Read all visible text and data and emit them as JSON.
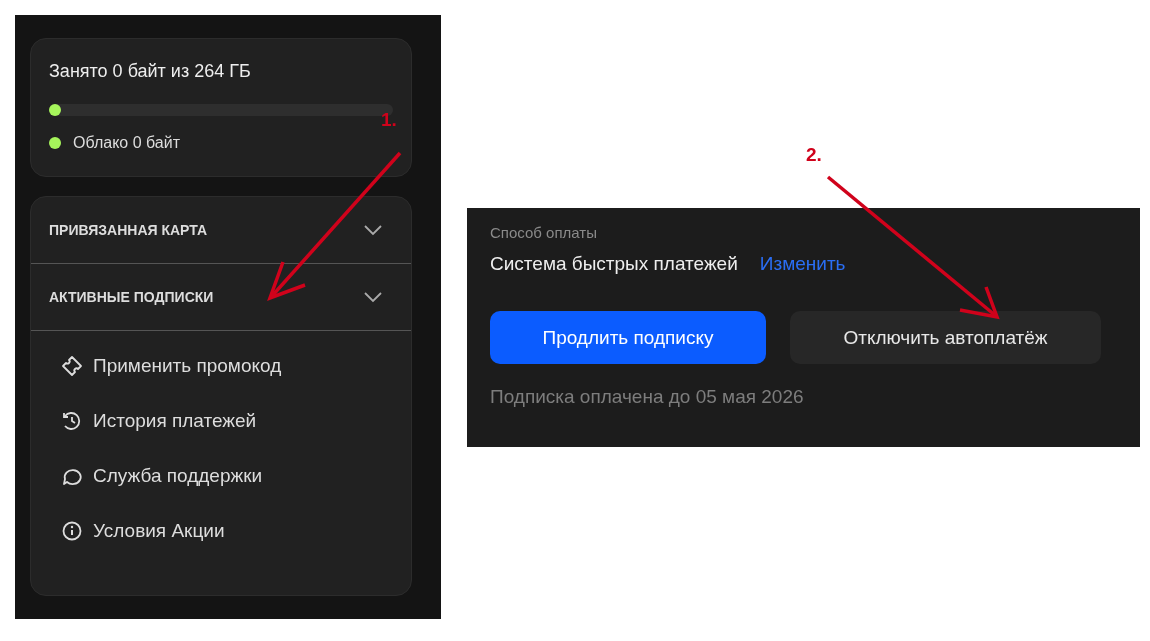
{
  "panel_1": {
    "storage": {
      "title": "Занято 0 байт из 264 ГБ",
      "level": 0,
      "color": "#a6f55b",
      "legend": [
        {
          "label": "Облако 0 байт",
          "color": "#a6f55b"
        }
      ]
    },
    "sections": [
      {
        "label": "ПРИВЯЗАННАЯ КАРТА",
        "expanded": false
      },
      {
        "label": "АКТИВНЫЕ ПОДПИСКИ",
        "expanded": false
      }
    ],
    "menu": [
      {
        "label": "Применить промокод",
        "kind": "ticket"
      },
      {
        "label": "История платежей",
        "kind": "history"
      },
      {
        "label": "Служба поддержки",
        "kind": "chat"
      },
      {
        "label": "Условия Акции",
        "kind": "info"
      }
    ]
  },
  "panel_2": {
    "payment_label": "Способ оплаты",
    "payment_method": "Система быстрых платежей",
    "change_link": "Изменить",
    "buttons": [
      {
        "label": "Продлить подписку",
        "kind": "primary"
      },
      {
        "label": "Отключить автоплатёж",
        "kind": "secondary"
      }
    ],
    "note": "Подписка оплачена до 05 мая 2026"
  },
  "annotations": [
    {
      "label": "1."
    },
    {
      "label": "2."
    }
  ]
}
